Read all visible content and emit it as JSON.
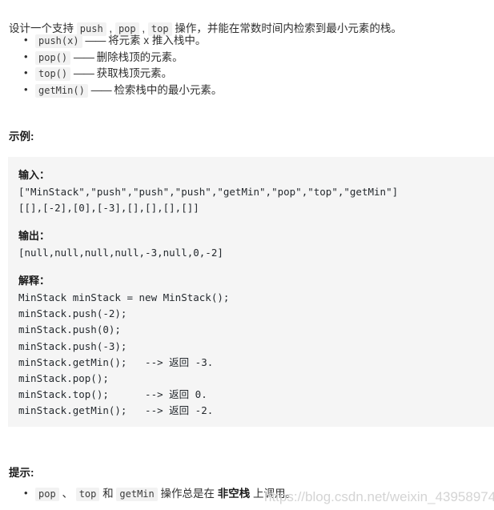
{
  "intro": {
    "before_push": "设计一个支持 ",
    "code_push": "push",
    "sep1": " , ",
    "code_pop": "pop",
    "sep2": " , ",
    "code_top": "top",
    "after_top": " 操作，并能在常数时间内检索到最小元素的栈。"
  },
  "operations": [
    {
      "code": "push(x)",
      "dash": "——",
      "desc": "将元素 x 推入栈中。"
    },
    {
      "code": "pop()",
      "dash": "——",
      "desc": "删除栈顶的元素。"
    },
    {
      "code": "top()",
      "dash": "——",
      "desc": "获取栈顶元素。"
    },
    {
      "code": "getMin()",
      "dash": "——",
      "desc": "检索栈中的最小元素。"
    }
  ],
  "sections": {
    "example_heading": "示例:",
    "hint_heading": "提示:"
  },
  "example": {
    "input_label": "输入：",
    "input_code": "[\"MinStack\",\"push\",\"push\",\"push\",\"getMin\",\"pop\",\"top\",\"getMin\"]\n[[],[-2],[0],[-3],[],[],[],[]]",
    "output_label": "输出：",
    "output_code": "[null,null,null,null,-3,null,0,-2]",
    "explain_label": "解释：",
    "explain_code": "MinStack minStack = new MinStack();\nminStack.push(-2);\nminStack.push(0);\nminStack.push(-3);\nminStack.getMin();   --> 返回 -3.\nminStack.pop();\nminStack.top();      --> 返回 0.\nminStack.getMin();   --> 返回 -2."
  },
  "hint": {
    "code_pop": "pop",
    "sep1": " 、 ",
    "code_top": "top",
    "sep2": " 和 ",
    "code_getmin": "getMin",
    "mid": " 操作总是在 ",
    "bold": "非空栈",
    "tail": " 上调用。"
  },
  "watermark": {
    "text": "https://blog.csdn.net/weixin_43958974"
  },
  "colors": {
    "page_background": "#ffffff",
    "panel_background": "#f5f5f5",
    "chip_background": "#f2f2f2",
    "text": "#2f2f2f",
    "code_text": "#24292e",
    "watermark": "#d4d4d4"
  }
}
